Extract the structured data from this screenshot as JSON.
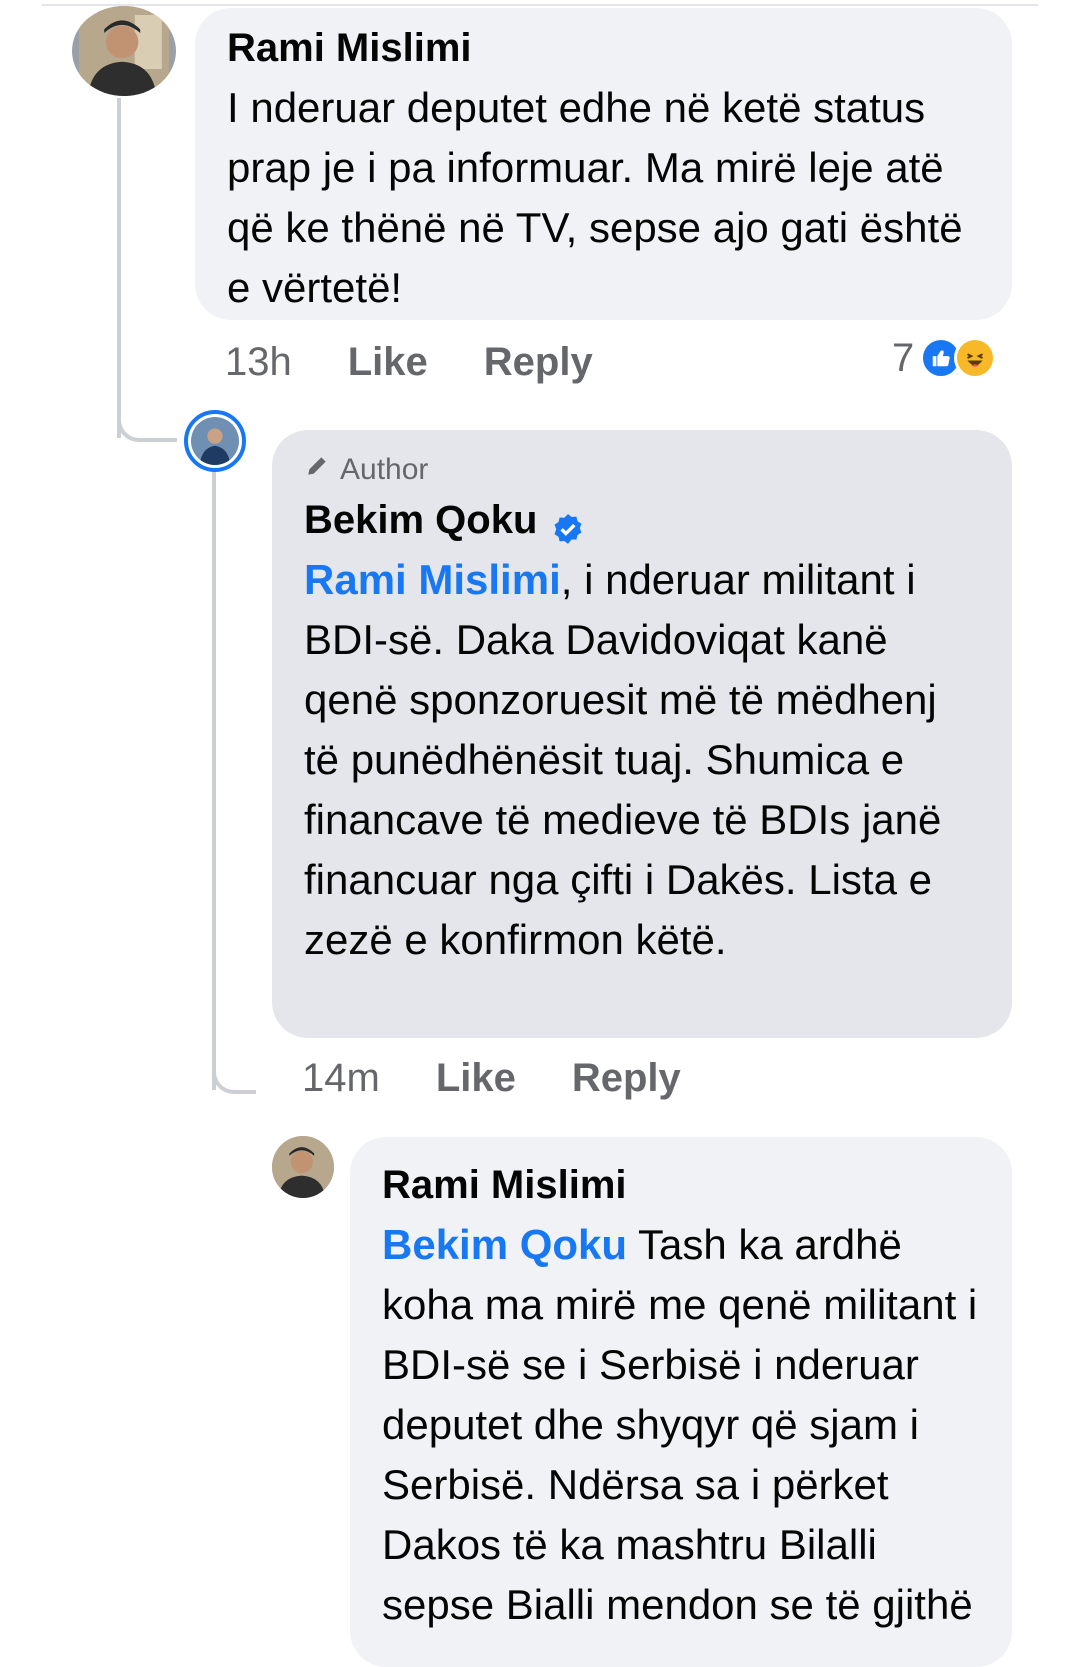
{
  "comments": [
    {
      "author": "Rami Mislimi",
      "text": "I nderuar deputet edhe në ketë status prap je i pa informuar. Ma mirë leje atë që ke thënë në TV, sepse ajo gati është e vërtetë!",
      "time": "13h",
      "like_label": "Like",
      "reply_label": "Reply",
      "reaction_count": "7",
      "reaction_icons": [
        "like-icon",
        "haha-icon"
      ]
    },
    {
      "badge": "Author",
      "author": "Bekim Qoku",
      "verified": true,
      "mention": "Rami Mislimi",
      "text": ", i nderuar militant i BDI-së. Daka Davidoviqat kanë qenë sponzoruesit më të mëdhenj të punëdhënësit tuaj. Shumica e financave të medieve të BDIs janë financuar nga çifti i Dakës. Lista e zezë e konfirmon këtë.",
      "time": "14m",
      "like_label": "Like",
      "reply_label": "Reply"
    },
    {
      "author": "Rami Mislimi",
      "mention": "Bekim Qoku",
      "text": " Tash ka ardhë koha ma mirë me qenë militant i BDI-së se i Serbisë i nderuar deputet dhe shyqyr që sjam i Serbisë. Ndërsa sa i përket Dakos të ka mashtru Bilalli sepse Bialli mendon se të gjithë"
    }
  ],
  "colors": {
    "mention": "#1877f2",
    "muted": "#65676b",
    "bubble": "#f0f2f5",
    "author_bubble": "#e4e6eb",
    "like_blue": "#1877f2",
    "haha_yellow": "#f7b928"
  }
}
